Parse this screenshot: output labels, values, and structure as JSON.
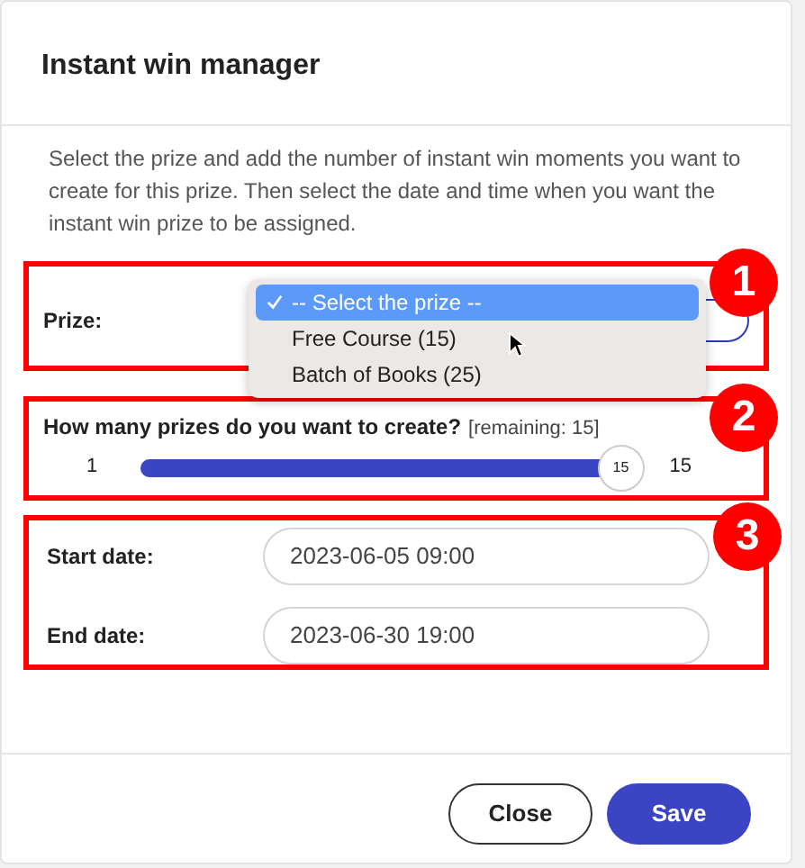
{
  "modal": {
    "title": "Instant win manager",
    "description": "Select the prize and add the number of instant win moments you want to create for this prize. Then select the date and time when you want the instant win prize to be assigned."
  },
  "prize": {
    "label": "Prize:",
    "options": [
      {
        "label": "-- Select the prize --",
        "selected": true
      },
      {
        "label": "Free Course (15)",
        "selected": false
      },
      {
        "label": "Batch of Books (25)",
        "selected": false
      }
    ]
  },
  "quantity": {
    "question": "How many prizes do you want to create?",
    "remaining": "[remaining: 15]",
    "min": "1",
    "max": "15",
    "thumb": "15",
    "level": 1
  },
  "dates": [
    {
      "label": "Start date:",
      "value": "2023-06-05 09:00"
    },
    {
      "label": "End date:",
      "value": "2023-06-30 19:00"
    }
  ],
  "buttons": [
    {
      "label": "Close",
      "kind": "secondary"
    },
    {
      "label": "Save",
      "kind": "primary"
    }
  ],
  "callouts": [
    "1",
    "2",
    "3"
  ]
}
